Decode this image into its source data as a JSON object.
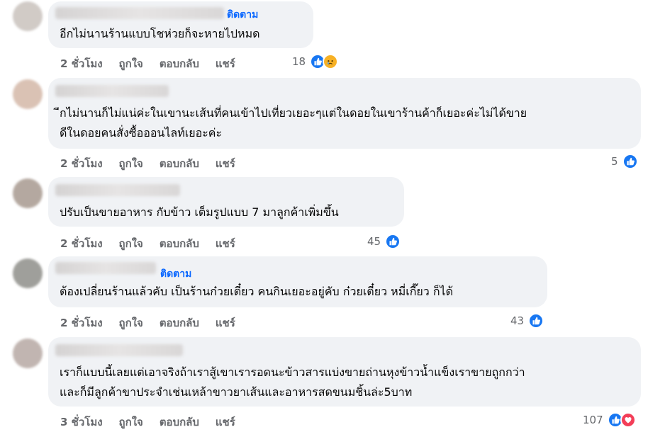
{
  "actions": {
    "like": "ถูกใจ",
    "reply": "ตอบกลับ",
    "share": "แชร์"
  },
  "comments": [
    {
      "follow": "ติดตาม",
      "line1": "อีกไม่นานร้านแบบโชห่วยก็จะหายไปหมด",
      "line2": "",
      "time": "2 ชั่วโมง",
      "count": "18",
      "reactions": [
        "like-icon",
        "sad-icon"
      ]
    },
    {
      "follow": "",
      "line1": "ีกไม่นานก็ไม่แน่ค่ะในเขานะเส้นที่คนเข้าไปเที่ยวเยอะๆแต่ในดอยในเขาร้านค้าก็เยอะค่ะไม่ได้ขาย",
      "line2": "ดีในดอยคนสั่งซื้อออนไลท์เยอะค่ะ",
      "time": "2 ชั่วโมง",
      "count": "5",
      "reactions": [
        "like-icon"
      ]
    },
    {
      "follow": "",
      "line1": "ปรับเป็นขายอาหาร กับข้าว เต็มรูปแบบ 7 มาลูกค้าเพิ่มขึ้น",
      "line2": "",
      "time": "2 ชั่วโมง",
      "count": "45",
      "reactions": [
        "like-icon"
      ]
    },
    {
      "follow": "ติดตาม",
      "line1": "ต้องเปลี่ยนร้านแล้วคับ เป็นร้านก๋วยเตี๋ยว คนกินเยอะอยู่คับ ก๋วยเตี๋ยว หมี่เกี๊ยว ก็ได้",
      "line2": "",
      "time": "2 ชั่วโมง",
      "count": "43",
      "reactions": [
        "like-icon"
      ]
    },
    {
      "follow": "",
      "line1": "เราก็แบบนี้เลยแต่เอาจริงถ้าเราสู้เขาเรารอดนะข้าวสารแบ่งขายถ่านหุงข้าวน้ำแข็งเราขายถูกกว่า",
      "line2": "และก็มีลูกค้าขาประจำเช่นเหล้าขาวยาเส้นและอาหารสดขนมชิ้นล่ะ5บาท",
      "time": "3 ชั่วโมง",
      "count": "107",
      "reactions": [
        "like-icon",
        "love-icon"
      ]
    }
  ],
  "colors": {
    "bubble": "#f0f2f5",
    "link": "#0866ff",
    "meta": "#65676b",
    "like": "#1877f2",
    "love": "#f33e58",
    "sad": "#f7b125"
  }
}
